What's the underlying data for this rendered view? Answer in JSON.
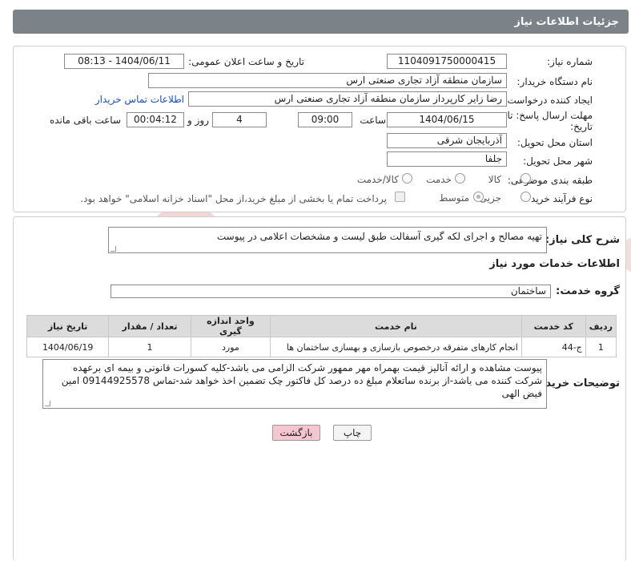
{
  "header": {
    "title": "جزئیات اطلاعات نیاز"
  },
  "info": {
    "need_number_label": "شماره نیاز:",
    "need_number": "1104091750000415",
    "announce_label": "تاریخ و ساعت اعلان عمومی:",
    "announce_value": "1404/06/11 - 08:13",
    "buyer_org_label": "نام دستگاه خریدار:",
    "buyer_org": "سازمان منطقه آزاد تجاری صنعتی ارس",
    "creator_label": "ایجاد کننده درخواست:",
    "creator": "رضا زایر کارپرداز سازمان منطقه آزاد تجاری صنعتی ارس",
    "contact_link": "اطلاعات تماس خریدار",
    "deadline_label_1": "مهلت ارسال پاسخ: تا",
    "deadline_label_2": "تاریخ:",
    "deadline_date": "1404/06/15",
    "time_label": "ساعت",
    "deadline_time": "09:00",
    "days_value": "4",
    "days_label": "روز و",
    "remaining_value": "00:04:12",
    "remaining_label": "ساعت باقی مانده",
    "province_label": "استان محل تحویل:",
    "province": "آذربایجان شرقی",
    "city_label": "شهر محل تحویل:",
    "city": "جلفا",
    "category_label": "طبقه بندی موضوعی:",
    "category_options": [
      "کالا",
      "خدمت",
      "کالا/خدمت"
    ],
    "process_label": "نوع فرآیند خرید :",
    "process_options": [
      "جزیی",
      "متوسط"
    ],
    "payment_note": "پرداخت تمام یا بخشی از مبلغ خرید،از محل \"اسناد خزانه اسلامی\" خواهد بود."
  },
  "description": {
    "label": "شرح کلی نیاز:",
    "value": "تهیه مصالح و اجرای لکه گیری آسفالت طبق لیست و مشخصات اعلامی در پیوست"
  },
  "services": {
    "title": "اطلاعات خدمات مورد نیاز",
    "group_label": "گروه خدمت:",
    "group_value": "ساختمان",
    "columns": [
      "ردیف",
      "کد خدمت",
      "نام خدمت",
      "واحد اندازه گیری",
      "تعداد / مقدار",
      "تاریخ نیاز"
    ],
    "rows": [
      [
        "1",
        "ج-44",
        "انجام کارهای متفرقه درخصوص بازسازی و بهسازی ساختمان ها",
        "مورد",
        "1",
        "1404/06/19"
      ]
    ]
  },
  "buyer_notes": {
    "label": "توضیحات خریدار:",
    "value": "پیوست مشاهده و ارائه آنالیز قیمت بهمراه مهر ممهور شرکت الزامی می باشد-کلیه کسورات قانونی و بیمه ای برعهده شرکت کننده می باشد-از برنده ساتعلام مبلغ ده درصد کل فاکتور چک تضمین اخذ خواهد شد-تماس 09144925578 امین فیض الهی"
  },
  "buttons": {
    "print": "چاپ",
    "back": "بازگشت"
  },
  "colors": {
    "header": "#7b8388",
    "back_button": "#f5c6cf",
    "watermark": "#f3dcdc"
  },
  "watermark": {
    "text": "AriaTender.neT"
  }
}
